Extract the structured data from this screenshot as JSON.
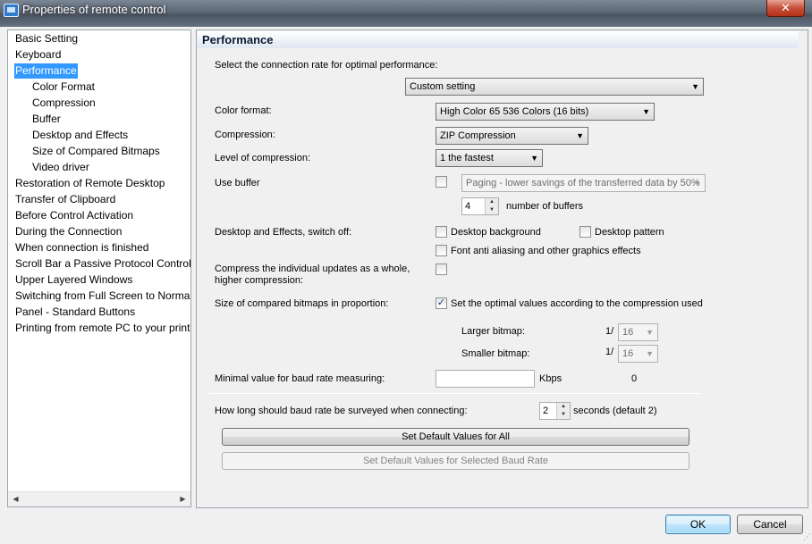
{
  "window": {
    "title": "Properties of remote control",
    "close_label": "✕"
  },
  "tree": {
    "items": [
      {
        "label": "Basic Setting",
        "level": 0,
        "selected": false
      },
      {
        "label": "Keyboard",
        "level": 0,
        "selected": false
      },
      {
        "label": "Performance",
        "level": 0,
        "selected": true
      },
      {
        "label": "Color Format",
        "level": 1,
        "selected": false
      },
      {
        "label": "Compression",
        "level": 1,
        "selected": false
      },
      {
        "label": "Buffer",
        "level": 1,
        "selected": false
      },
      {
        "label": "Desktop and Effects",
        "level": 1,
        "selected": false
      },
      {
        "label": "Size of Compared Bitmaps",
        "level": 1,
        "selected": false
      },
      {
        "label": "Video driver",
        "level": 1,
        "selected": false
      },
      {
        "label": "Restoration of Remote Desktop",
        "level": 0,
        "selected": false
      },
      {
        "label": "Transfer of Clipboard",
        "level": 0,
        "selected": false
      },
      {
        "label": "Before Control Activation",
        "level": 0,
        "selected": false
      },
      {
        "label": "During the Connection",
        "level": 0,
        "selected": false
      },
      {
        "label": "When connection is finished",
        "level": 0,
        "selected": false
      },
      {
        "label": "Scroll Bar a Passive Protocol Control",
        "level": 0,
        "selected": false
      },
      {
        "label": "Upper Layered Windows",
        "level": 0,
        "selected": false
      },
      {
        "label": "Switching from Full Screen to Normal",
        "level": 0,
        "selected": false
      },
      {
        "label": "Panel - Standard Buttons",
        "level": 0,
        "selected": false
      },
      {
        "label": "Printing from remote PC to your printer",
        "level": 0,
        "selected": false
      }
    ],
    "scroll_left": "◀",
    "scroll_right": "▶"
  },
  "panel": {
    "header": "Performance",
    "rate_label": "Select the connection rate for optimal performance:",
    "rate_value": "Custom setting",
    "color_format_label": "Color format:",
    "color_format_value": "High Color 65 536 Colors (16 bits)",
    "compression_label": "Compression:",
    "compression_value": "ZIP Compression",
    "level_label": "Level of compression:",
    "level_value": "1 the fastest",
    "buffer_label": "Use buffer",
    "buffer_checked": false,
    "buffer_mode_value": "Paging - lower savings of the transferred data by 50%",
    "buffer_count": "4",
    "buffer_count_label": "number of buffers",
    "desktop_label": "Desktop and Effects, switch off:",
    "desktop_background_label": "Desktop background",
    "desktop_pattern_label": "Desktop pattern",
    "font_aa_label": "Font anti aliasing and other graphics effects",
    "compress_whole_label": "Compress the individual updates as a whole, higher compression:",
    "bitmaps_label": "Size of compared bitmaps in proportion:",
    "bitmaps_optimal_label": "Set the optimal values according to the compression used",
    "bitmaps_optimal_checked": true,
    "larger_label": "Larger bitmap:",
    "larger_prefix": "1/",
    "larger_value": "16",
    "smaller_label": "Smaller bitmap:",
    "smaller_prefix": "1/",
    "smaller_value": "16",
    "baud_min_label": "Minimal value for baud rate measuring:",
    "baud_unit": "Kbps",
    "baud_reading": "0",
    "survey_label": "How long should baud rate be surveyed when connecting:",
    "survey_value": "2",
    "survey_suffix": "seconds (default 2)",
    "default_all_label": "Set Default Values for All",
    "default_selected_label": "Set Default Values for Selected Baud Rate"
  },
  "footer": {
    "ok_label": "OK",
    "cancel_label": "Cancel"
  },
  "icons": {
    "check_mark": "✓",
    "dropdown_arrow": "▼",
    "spin_up": "▲",
    "spin_down": "▼",
    "grip": "⋰"
  },
  "colors": {
    "selection": "#3399ff",
    "accent": "#3c7fb1"
  }
}
